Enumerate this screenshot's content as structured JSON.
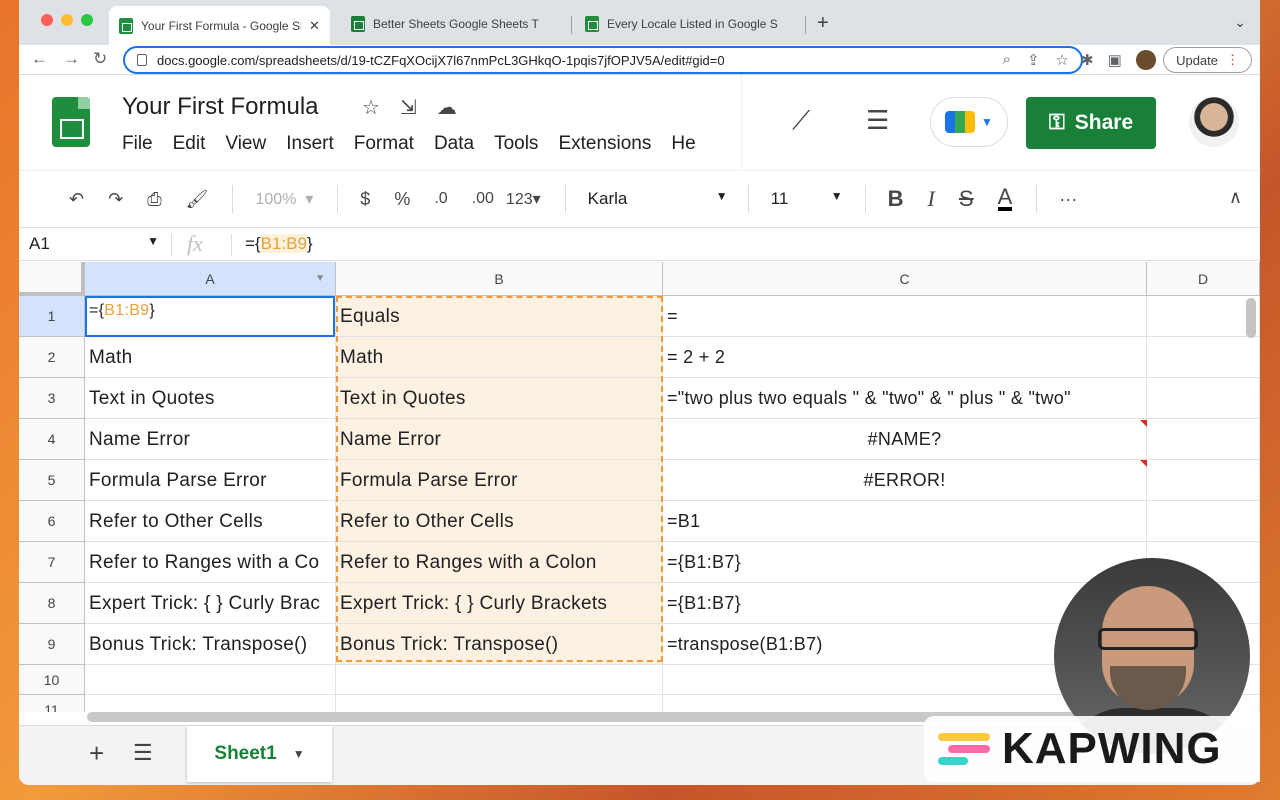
{
  "browser": {
    "tabs": [
      {
        "title": "Your First Formula - Google Sh",
        "active": true
      },
      {
        "title": "Better Sheets Google Sheets T",
        "active": false
      },
      {
        "title": "Every Locale Listed in Google S",
        "active": false
      }
    ],
    "url": "docs.google.com/spreadsheets/d/19-tCZFqXOcijX7l67nmPcL3GHkqO-1pqis7jfOPJV5A/edit#gid=0",
    "update_label": "Update"
  },
  "doc": {
    "title": "Your First Formula",
    "menu": [
      "File",
      "Edit",
      "View",
      "Insert",
      "Format",
      "Data",
      "Tools",
      "Extensions",
      "He"
    ],
    "share_label": "Share"
  },
  "toolbar": {
    "zoom": "100%",
    "currency": "$",
    "percent": "%",
    "dec_less": ".0",
    "dec_more": ".00",
    "number_format": "123",
    "font": "Karla",
    "font_size": "11",
    "bold": "B",
    "italic": "I",
    "strike": "S",
    "text_color": "A",
    "more": "···"
  },
  "formula_bar": {
    "cell_ref": "A1",
    "fx": "fx",
    "formula_prefix": "={",
    "formula_range": "B1:B9",
    "formula_suffix": "}"
  },
  "columns": [
    "A",
    "B",
    "C",
    "D"
  ],
  "rows": [
    {
      "n": "1",
      "a": "",
      "b": "Equals",
      "c": "="
    },
    {
      "n": "2",
      "a": "Math",
      "b": "Math",
      "c": "= 2 + 2"
    },
    {
      "n": "3",
      "a": "Text in Quotes",
      "b": "Text in Quotes",
      "c": "=\"two plus two equals \" & \"two\" & \" plus \" & \"two\""
    },
    {
      "n": "4",
      "a": "Name Error",
      "b": "Name Error",
      "c": "#NAME?"
    },
    {
      "n": "5",
      "a": "Formula Parse Error",
      "b": "Formula Parse Error",
      "c": "#ERROR!"
    },
    {
      "n": "6",
      "a": "Refer to Other Cells",
      "b": "Refer to Other Cells",
      "c": "=B1"
    },
    {
      "n": "7",
      "a": "Refer to Ranges with a Co",
      "b": "Refer to Ranges with a Colon",
      "c": "={B1:B7}"
    },
    {
      "n": "8",
      "a": "Expert Trick: { } Curly Brac",
      "b": "Expert Trick: { } Curly Brackets",
      "c": "={B1:B7}"
    },
    {
      "n": "9",
      "a": "Bonus Trick: Transpose()",
      "b": "Bonus Trick: Transpose()",
      "c": "=transpose(B1:B7)"
    },
    {
      "n": "10",
      "a": "",
      "b": "",
      "c": ""
    },
    {
      "n": "11",
      "a": "",
      "b": "",
      "c": ""
    }
  ],
  "a1_cell": {
    "prefix": "={",
    "range": "B1:B9",
    "suffix": "}"
  },
  "sheet_tab": "Sheet1",
  "watermark": "KAPWING",
  "colors": {
    "accent": "#1a73e8",
    "share": "#188038",
    "range_highlight": "#f29a3c"
  }
}
